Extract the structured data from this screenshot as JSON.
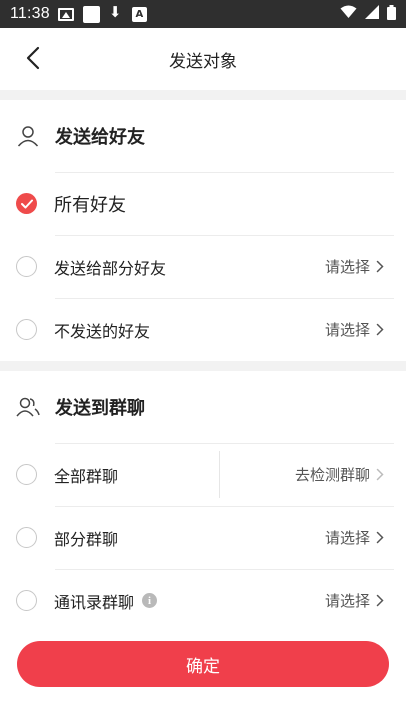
{
  "status_bar": {
    "time": "11:38",
    "left_icons": [
      "image-icon",
      "square-icon",
      "download-icon",
      "a-icon"
    ],
    "right_icons": [
      "wifi-icon",
      "cellular-icon",
      "battery-icon"
    ]
  },
  "header": {
    "title": "发送对象",
    "back_icon": "chevron-left-icon"
  },
  "friends_section": {
    "title": "发送给好友",
    "icon": "person-icon",
    "options": [
      {
        "label": "所有好友",
        "checked": true,
        "action": ""
      },
      {
        "label": "发送给部分好友",
        "checked": false,
        "action": "请选择"
      },
      {
        "label": "不发送的好友",
        "checked": false,
        "action": "请选择"
      }
    ]
  },
  "groups_section": {
    "title": "发送到群聊",
    "icon": "group-icon",
    "options": [
      {
        "label": "全部群聊",
        "checked": false,
        "action": "去检测群聊"
      },
      {
        "label": "部分群聊",
        "checked": false,
        "action": "请选择"
      },
      {
        "label": "通讯录群聊",
        "checked": false,
        "action": "请选择",
        "info_icon": "i"
      }
    ]
  },
  "confirm_button": {
    "label": "确定"
  },
  "colors": {
    "accent": "#f03f4b",
    "check": "#ef4b4b",
    "divider": "#ececec",
    "section_gap": "#f2f2f2"
  }
}
